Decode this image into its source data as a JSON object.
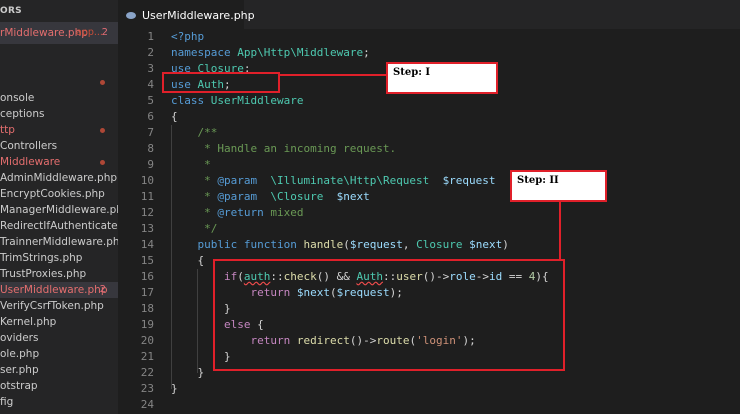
{
  "sidebar": {
    "header": "ORS",
    "open_file": {
      "name": "rMiddleware.php",
      "path": "app...",
      "count": "2"
    },
    "items": [
      {
        "label": "",
        "dot": true,
        "color": "#e46e6e"
      },
      {
        "label": "onsole"
      },
      {
        "label": "ceptions"
      },
      {
        "label": "ttp",
        "dot": true,
        "color": "#e46e6e"
      },
      {
        "label": "Controllers"
      },
      {
        "label": "Middleware",
        "dot": true,
        "color": "#e46e6e"
      },
      {
        "label": "AdminMiddleware.php"
      },
      {
        "label": "EncryptCookies.php"
      },
      {
        "label": "ManagerMiddleware.php"
      },
      {
        "label": "RedirectIfAuthenticated.p..."
      },
      {
        "label": "TrainnerMiddleware.php"
      },
      {
        "label": "TrimStrings.php"
      },
      {
        "label": "TrustProxies.php"
      },
      {
        "label": "UserMiddleware.php",
        "count": "2",
        "color": "#e46e6e",
        "active": true
      },
      {
        "label": "VerifyCsrfToken.php"
      },
      {
        "label": "Kernel.php"
      },
      {
        "label": "oviders"
      },
      {
        "label": "ole.php"
      },
      {
        "label": "ser.php"
      },
      {
        "label": "otstrap"
      },
      {
        "label": "fig"
      }
    ]
  },
  "tab": {
    "label": "UserMiddleware.php"
  },
  "editor": {
    "lines": [
      {
        "n": "1",
        "html": "<span class='k'>&lt;?php</span>"
      },
      {
        "n": "2",
        "html": "<span class='k'>namespace</span> <span class='t'>App\\Http\\Middleware</span>;"
      },
      {
        "n": "3",
        "html": "<span class='k'>use</span> <span class='t'>Closure</span>;"
      },
      {
        "n": "4",
        "html": "<span class='k'>use</span> <span class='t'>Auth</span>;"
      },
      {
        "n": "5",
        "html": "<span class='k'>class</span> <span class='t'>UserMiddleware</span>"
      },
      {
        "n": "6",
        "html": "{"
      },
      {
        "n": "7",
        "html": "    <span class='c'>/**</span>"
      },
      {
        "n": "8",
        "html": "<span class='c'>     * Handle an incoming request.</span>"
      },
      {
        "n": "9",
        "html": "<span class='c'>     *</span>"
      },
      {
        "n": "10",
        "html": "<span class='c'>     * </span><span class='k'>@param</span><span class='c'>  </span><span class='t'>\\Illuminate\\Http\\Request</span><span class='c'>  </span><span class='v'>$request</span>"
      },
      {
        "n": "11",
        "html": "<span class='c'>     * </span><span class='k'>@param</span><span class='c'>  </span><span class='t'>\\Closure</span><span class='c'>  </span><span class='v'>$next</span>"
      },
      {
        "n": "12",
        "html": "<span class='c'>     * </span><span class='k'>@return</span><span class='c'> mixed</span>"
      },
      {
        "n": "13",
        "html": "<span class='c'>     */</span>"
      },
      {
        "n": "14",
        "html": "    <span class='k'>public</span> <span class='k'>function</span> <span class='f'>handle</span>(<span class='v'>$request</span>, <span class='t'>Closure</span> <span class='v'>$next</span>)"
      },
      {
        "n": "15",
        "html": "    {"
      },
      {
        "n": "16",
        "html": "        <span class='p'>if</span>(<span class='t sq'>auth</span>::<span class='f'>check</span>() &amp;&amp; <span class='t sq'>Auth</span>::<span class='f'>user</span>()-&gt;<span class='v'>role</span>-&gt;<span class='v'>id</span> == <span class='n'>4</span>){"
      },
      {
        "n": "17",
        "html": "            <span class='p'>return</span> <span class='v'>$next</span>(<span class='v'>$request</span>);"
      },
      {
        "n": "18",
        "html": "        }"
      },
      {
        "n": "19",
        "html": "        <span class='p'>else</span> {"
      },
      {
        "n": "20",
        "html": "            <span class='p'>return</span> <span class='f'>redirect</span>()-&gt;<span class='f'>route</span>(<span class='s'>'login'</span>);"
      },
      {
        "n": "21",
        "html": "        }"
      },
      {
        "n": "22",
        "html": "    }"
      },
      {
        "n": "23",
        "html": "}"
      },
      {
        "n": "24",
        "html": ""
      }
    ]
  },
  "annotations": {
    "step1": "Step: I",
    "step2": "Step: II"
  }
}
